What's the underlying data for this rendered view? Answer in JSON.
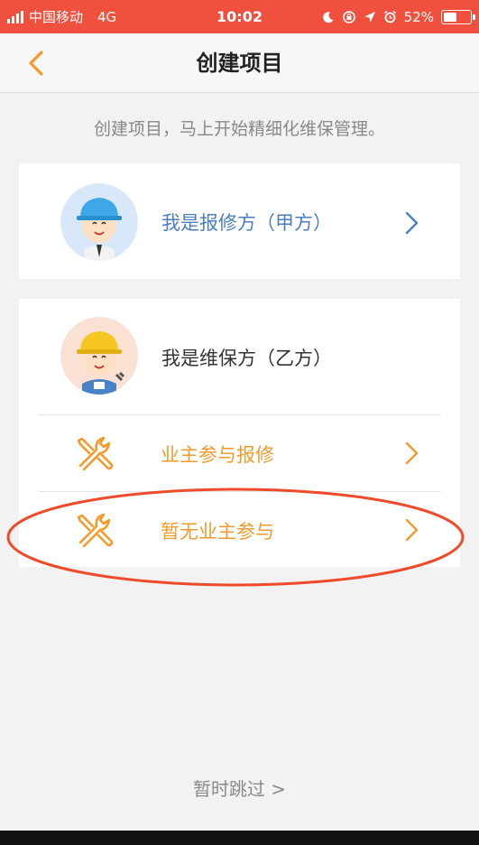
{
  "status_bar": {
    "carrier": "中国移动",
    "network": "4G",
    "time": "10:02",
    "battery_percent": "52%",
    "battery_level": 0.52
  },
  "nav": {
    "title": "创建项目",
    "back_icon": "chevron-left-icon"
  },
  "subtitle": "创建项目，马上开始精细化维保管理。",
  "options": {
    "client": {
      "label": "我是报修方（甲方）",
      "avatar_icon": "worker-blue-helmet-icon"
    },
    "maintainer": {
      "label": "我是维保方（乙方）",
      "avatar_icon": "worker-yellow-helmet-icon",
      "sub_items": [
        {
          "label": "业主参与报修",
          "icon": "tools-icon"
        },
        {
          "label": "暂无业主参与",
          "icon": "tools-icon"
        }
      ]
    }
  },
  "skip": "暂时跳过 >",
  "colors": {
    "status_bar": "#f0513f",
    "accent_orange": "#f39a2b",
    "link_blue": "#4a7fbf",
    "annotation": "#ef4a2a"
  }
}
